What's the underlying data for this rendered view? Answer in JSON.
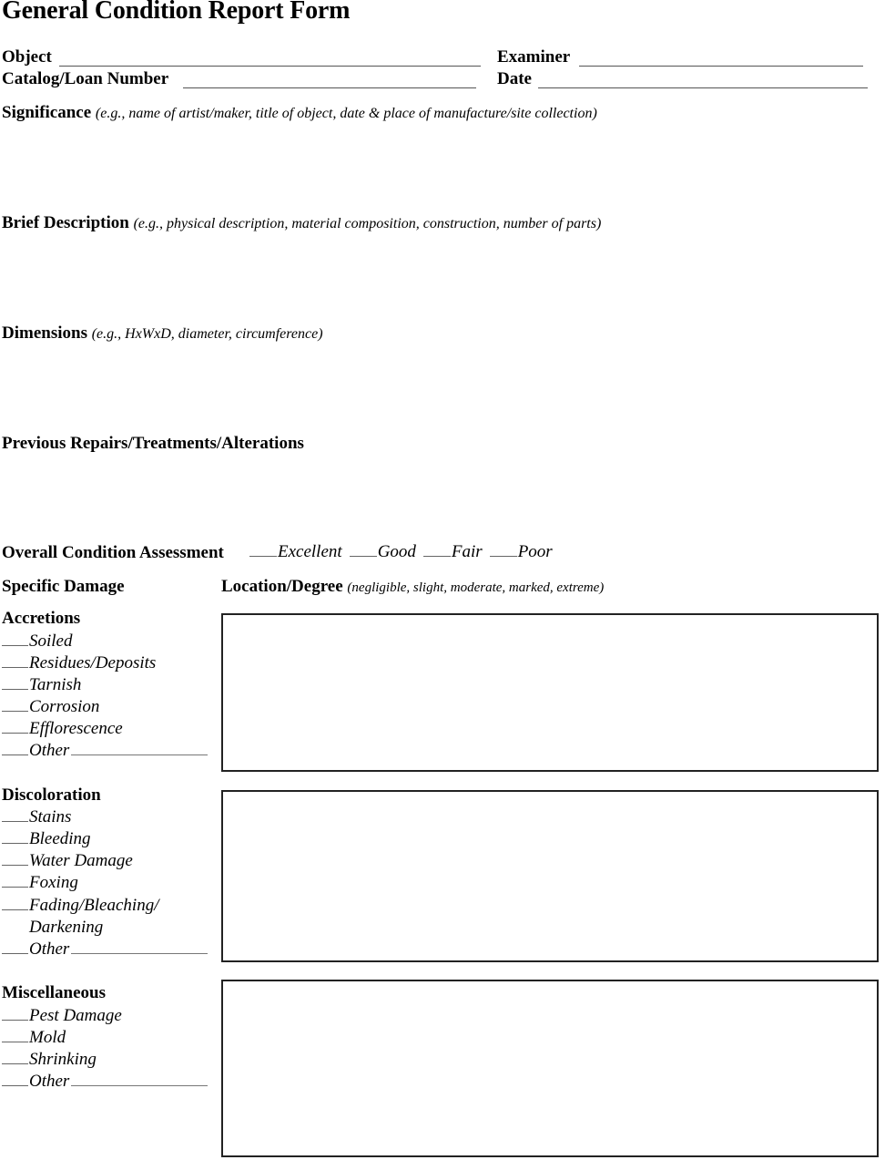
{
  "title": "General Condition Report Form",
  "header_fields": {
    "object": {
      "label": "Object",
      "value": ""
    },
    "examiner": {
      "label": "Examiner",
      "value": ""
    },
    "catalog_loan_number": {
      "label": "Catalog/Loan Number",
      "value": ""
    },
    "date": {
      "label": "Date",
      "value": ""
    }
  },
  "sections": {
    "significance": {
      "label": "Significance",
      "hint": "(e.g., name of artist/maker, title of object, date & place of manufacture/site collection)",
      "value": ""
    },
    "brief_description": {
      "label": "Brief Description",
      "hint": "(e.g., physical description, material composition, construction, number of parts)",
      "value": ""
    },
    "dimensions": {
      "label": "Dimensions",
      "hint": "(e.g., HxWxD, diameter, circumference)",
      "value": ""
    },
    "previous_repairs": {
      "label": "Previous Repairs/Treatments/Alterations",
      "value": ""
    }
  },
  "overall_condition": {
    "label": "Overall Condition Assessment",
    "options": [
      "Excellent",
      "Good",
      "Fair",
      "Poor"
    ],
    "selected": null
  },
  "specific_damage": {
    "label": "Specific Damage",
    "location_label": "Location/Degree",
    "location_hint": "(negligible, slight, moderate, marked, extreme)",
    "groups": [
      {
        "name": "Accretions",
        "items": [
          "Soiled",
          "Residues/Deposits",
          "Tarnish",
          "Corrosion",
          "Efflorescence",
          "Other"
        ],
        "notes": ""
      },
      {
        "name": "Discoloration",
        "items": [
          "Stains",
          "Bleeding",
          "Water Damage",
          "Foxing",
          "Fading/Bleaching/",
          "Darkening",
          "Other"
        ],
        "notes": ""
      },
      {
        "name": "Miscellaneous",
        "items": [
          "Pest Damage",
          "Mold",
          "Shrinking",
          "Other"
        ],
        "notes": ""
      }
    ]
  }
}
